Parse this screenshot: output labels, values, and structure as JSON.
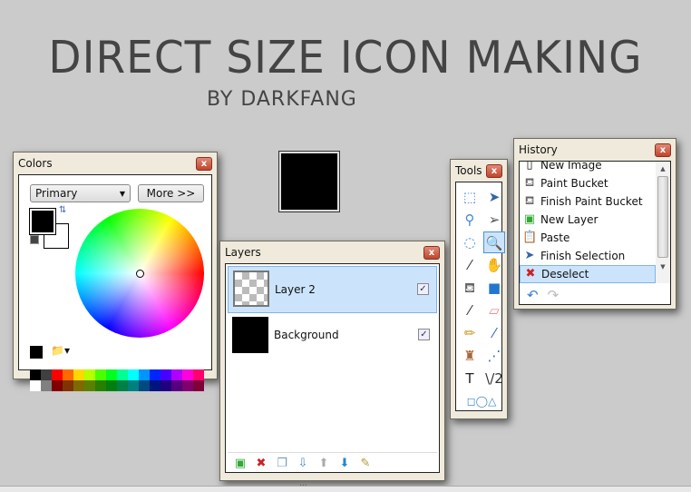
{
  "heading": {
    "title": "DIRECT SIZE ICON MAKING",
    "subtitle": "BY DARKFANG"
  },
  "colors": {
    "title": "Colors",
    "close": "x",
    "mode": "Primary",
    "more": "More >>",
    "palette_top": [
      "#000000",
      "#404040",
      "#ff0000",
      "#ff6a00",
      "#ffd800",
      "#b6ff00",
      "#4cff00",
      "#00ff21",
      "#00ff90",
      "#00ffff",
      "#0094ff",
      "#0026ff",
      "#4800ff",
      "#b200ff",
      "#ff00dc",
      "#ff006e"
    ],
    "palette_bottom": [
      "#ffffff",
      "#808080",
      "#7f0000",
      "#7f3300",
      "#7f6a00",
      "#5b7f00",
      "#267f00",
      "#007f0e",
      "#007f46",
      "#007f7f",
      "#004a7f",
      "#00137f",
      "#21007f",
      "#57007f",
      "#7f006e",
      "#7f0037"
    ],
    "primary": "#000000",
    "secondary": "#ffffff"
  },
  "layers": {
    "title": "Layers",
    "close": "x",
    "items": [
      {
        "name": "Layer 2",
        "visible": true,
        "selected": true
      },
      {
        "name": "Background",
        "visible": true,
        "selected": false
      }
    ],
    "toolbar": [
      "add-layer",
      "delete-layer",
      "duplicate-layer",
      "merge-layer-down",
      "move-layer-up",
      "move-layer-down",
      "layer-properties"
    ]
  },
  "tools": {
    "title": "Tools",
    "close": "x",
    "items": [
      "rectangle-select",
      "move-selection",
      "lasso-select",
      "move-selected",
      "ellipse-select",
      "zoom",
      "magic-wand",
      "pan",
      "paint-bucket",
      "gradient",
      "paintbrush",
      "eraser",
      "pencil",
      "color-picker",
      "clone-stamp",
      "recolor",
      "text",
      "line-curve",
      "shapes"
    ],
    "selected": "zoom"
  },
  "history": {
    "title": "History",
    "close": "x",
    "items": [
      "New Image",
      "Paint Bucket",
      "Finish Paint Bucket",
      "New Layer",
      "Paste",
      "Finish Selection",
      "Deselect"
    ],
    "selected": "Deselect",
    "undo": "undo",
    "redo": "redo"
  },
  "statusbar": {
    "grip": "..."
  }
}
